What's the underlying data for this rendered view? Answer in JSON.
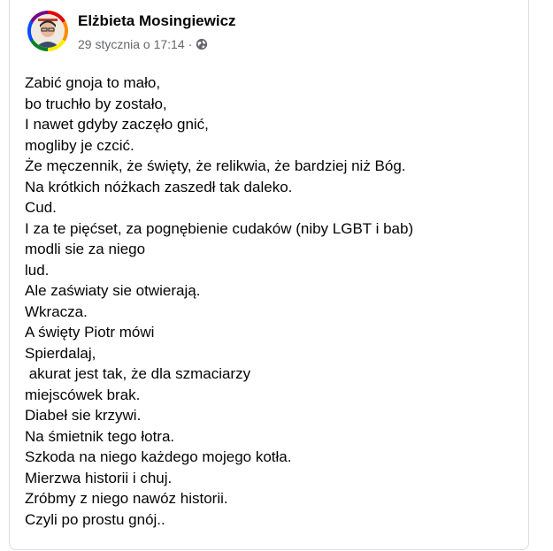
{
  "post": {
    "author": "Elżbieta Mosingiewicz",
    "timestamp": "29 stycznia o 17:14",
    "separator": "·",
    "privacy_icon": "globe-icon",
    "lines": [
      "Zabić gnoja to mało,",
      "bo truchło by zostało,",
      "I nawet gdyby zaczęło gnić,",
      "mogliby je czcić.",
      "Że męczennik, że święty, że relikwia, że bardziej niż Bóg.",
      "Na krótkich nóżkach zaszedł tak daleko.",
      "Cud.",
      "I za te pięćset, za pognębienie cudaków (niby LGBT i bab)",
      "modli sie za niego",
      "lud.",
      "Ale zaświaty sie otwierają.",
      "Wkracza.",
      "A święty Piotr mówi",
      "Spierdalaj,",
      " akurat jest tak, że dla szmaciarzy",
      "miejscówek brak.",
      "Diabeł sie krzywi.",
      "Na śmietnik tego łotra.",
      "Szkoda na niego każdego mojego kotła.",
      "Mierzwa historii i chuj.",
      "Zróbmy z niego nawóz historii.",
      "Czyli po prostu gnój.."
    ]
  },
  "colors": {
    "text_primary": "#050505",
    "text_secondary": "#65676b",
    "card_border": "#dadde1",
    "background": "#ffffff"
  }
}
